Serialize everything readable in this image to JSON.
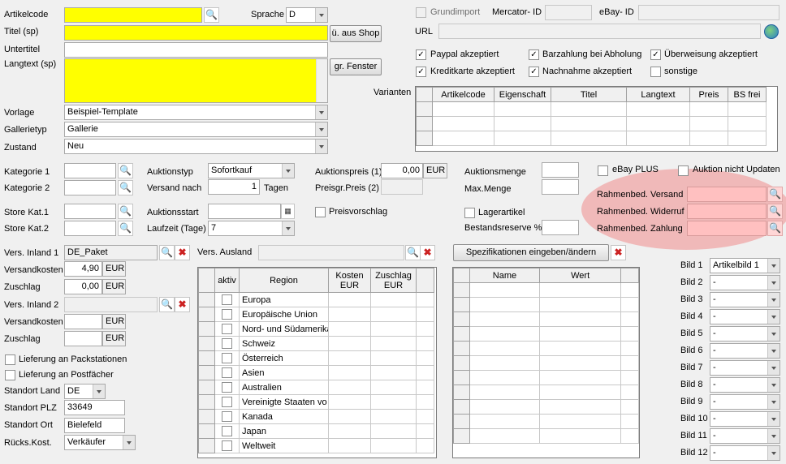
{
  "left": {
    "artikelcode_label": "Artikelcode",
    "artikelcode_value": "",
    "sprache_label": "Sprache",
    "sprache_value": "D",
    "titel_label": "Titel (sp)",
    "titel_value": "",
    "aus_shop_button": "ü. aus Shop",
    "untertitel_label": "Untertitel",
    "langtext_label": "Langtext (sp)",
    "gr_fenster_button": "gr. Fenster",
    "vorlage_label": "Vorlage",
    "vorlage_value": "Beispiel-Template",
    "gallerietyp_label": "Gallerietyp",
    "gallerietyp_value": "Gallerie",
    "zustand_label": "Zustand",
    "zustand_value": "Neu"
  },
  "top_right": {
    "grundimport_label": "Grundimport",
    "mercator_label": "Mercator- ID",
    "ebay_id_label": "eBay- ID",
    "url_label": "URL",
    "checks": [
      {
        "label": "Paypal akzeptiert",
        "checked": "✓"
      },
      {
        "label": "Barzahlung bei Abholung",
        "checked": "✓"
      },
      {
        "label": "Überweisung akzeptiert",
        "checked": "✓"
      },
      {
        "label": "Kreditkarte akzeptiert",
        "checked": "✓"
      },
      {
        "label": "Nachnahme akzeptiert",
        "checked": "✓"
      },
      {
        "label": "sonstige",
        "checked": ""
      }
    ],
    "varianten_label": "Varianten",
    "varianten_columns": [
      "Artikelcode",
      "Eigenschaft",
      "Titel",
      "Langtext",
      "Preis",
      "BS frei"
    ]
  },
  "auction": {
    "kategorie1_label": "Kategorie 1",
    "kategorie2_label": "Kategorie 2",
    "auktionstyp_label": "Auktionstyp",
    "auktionstyp_value": "Sofortkauf",
    "versand_nach_label": "Versand nach",
    "versand_nach_value": "1",
    "tagen_label": "Tagen",
    "auktionspreis_label": "Auktionspreis (1)",
    "auktionspreis_value": "0,00",
    "eur": "EUR",
    "preisgr_label": "Preisgr.Preis (2)",
    "auktionsmenge_label": "Auktionsmenge",
    "max_menge_label": "Max.Menge",
    "ebay_plus_label": "eBay PLUS",
    "auktion_nicht_updaten_label": "Auktion nicht Updaten",
    "rahmen_versand_label": "Rahmenbed. Versand",
    "rahmen_widerruf_label": "Rahmenbed. Widerruf",
    "rahmen_zahlung_label": "Rahmenbed. Zahlung",
    "store_kat1_label": "Store Kat.1",
    "store_kat2_label": "Store Kat.2",
    "auktionsstart_label": "Auktionsstart",
    "laufzeit_label": "Laufzeit (Tage)",
    "laufzeit_value": "7",
    "preisvorschlag_label": "Preisvorschlag",
    "lagerartikel_label": "Lagerartikel",
    "bestandsreserve_label": "Bestandsreserve %"
  },
  "shipping": {
    "vers_inland1_label": "Vers. Inland 1",
    "vers_inland1_value": "DE_Paket",
    "versandkosten_label": "Versandkosten",
    "versandkosten1_value": "4,90",
    "zuschlag_label": "Zuschlag",
    "zuschlag1_value": "0,00",
    "vers_inland2_label": "Vers. Inland 2",
    "lieferung_pack_label": "Lieferung an Packstationen",
    "lieferung_post_label": "Lieferung an Postfächer",
    "standort_land_label": "Standort Land",
    "standort_land_value": "DE",
    "standort_plz_label": "Standort PLZ",
    "standort_plz_value": "33649",
    "standort_ort_label": "Standort Ort",
    "standort_ort_value": "Bielefeld",
    "ruecks_label": "Rücks.Kost.",
    "ruecks_value": "Verkäufer",
    "vers_ausland_label": "Vers. Ausland"
  },
  "region_grid": {
    "col_aktiv": "aktiv",
    "col_region": "Region",
    "col_kosten": "Kosten\nEUR",
    "col_zuschlag": "Zuschlag\nEUR",
    "rows": [
      "Europa",
      "Europäische Union",
      "Nord- und Südamerika",
      "Schweiz",
      "Österreich",
      "Asien",
      "Australien",
      "Vereinigte Staaten vo",
      "Kanada",
      "Japan",
      "Weltweit"
    ]
  },
  "spec": {
    "button": "Spezifikationen eingeben/ändern",
    "col_name": "Name",
    "col_wert": "Wert"
  },
  "bilder": [
    {
      "label": "Bild 1",
      "value": "Artikelbild 1"
    },
    {
      "label": "Bild 2",
      "value": "-"
    },
    {
      "label": "Bild 3",
      "value": "-"
    },
    {
      "label": "Bild 4",
      "value": "-"
    },
    {
      "label": "Bild 5",
      "value": "-"
    },
    {
      "label": "Bild 6",
      "value": "-"
    },
    {
      "label": "Bild 7",
      "value": "-"
    },
    {
      "label": "Bild 8",
      "value": "-"
    },
    {
      "label": "Bild 9",
      "value": "-"
    },
    {
      "label": "Bild 10",
      "value": "-"
    },
    {
      "label": "Bild 11",
      "value": "-"
    },
    {
      "label": "Bild 12",
      "value": "-"
    }
  ]
}
